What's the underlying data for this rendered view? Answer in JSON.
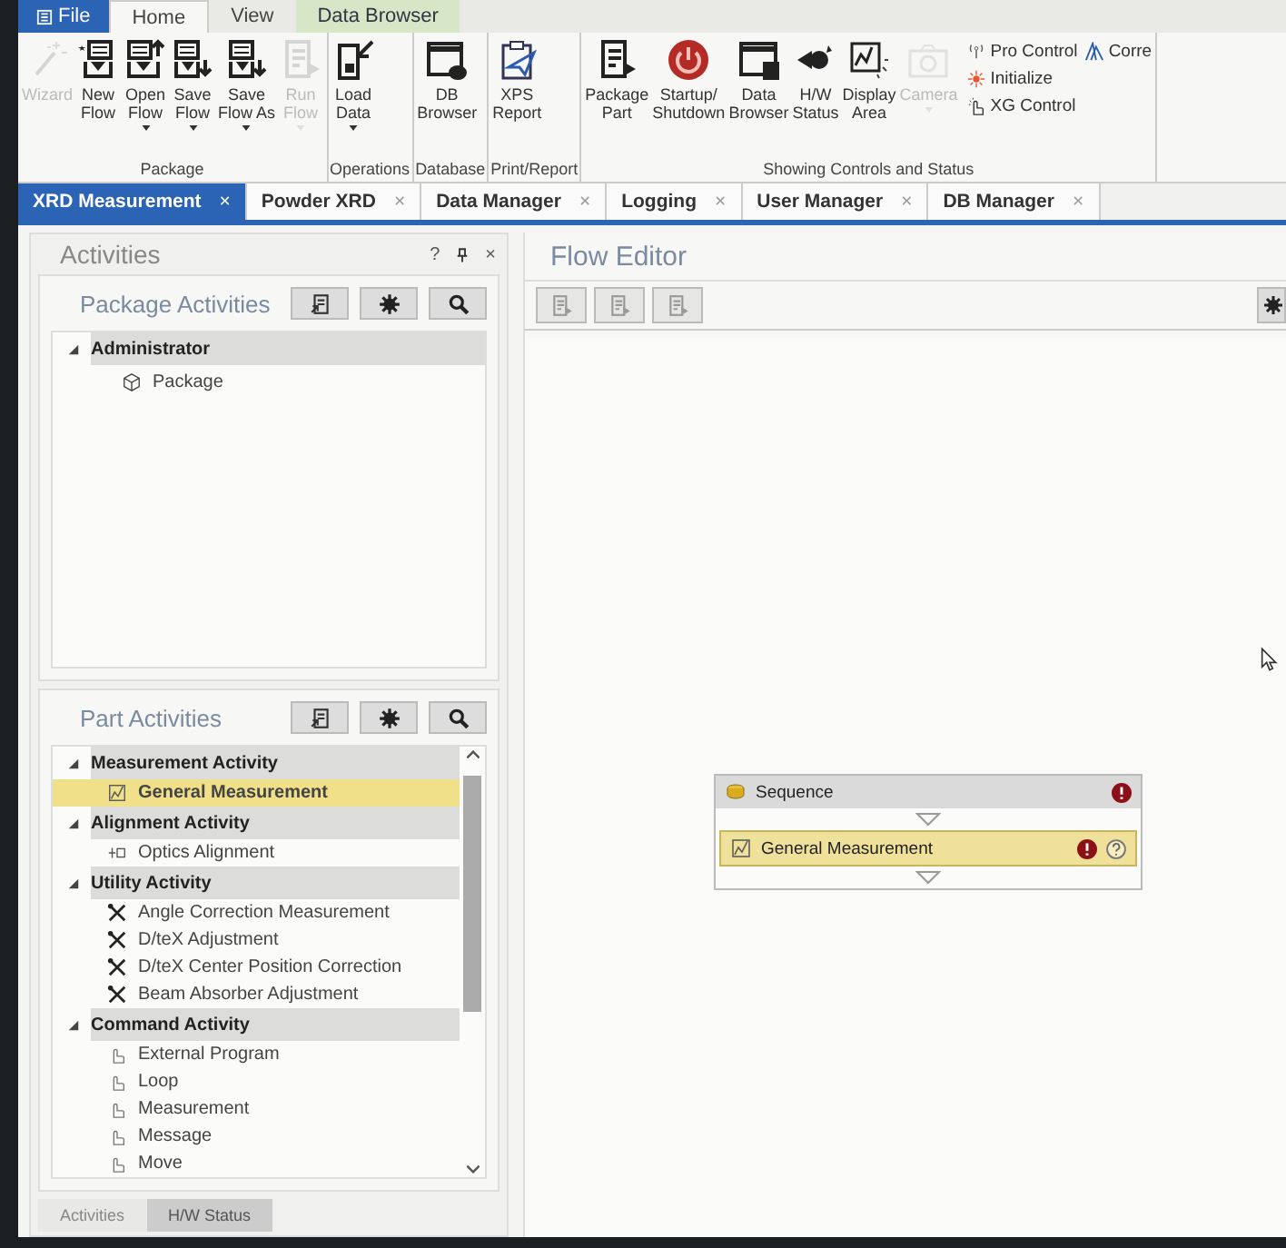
{
  "menu_tabs": [
    {
      "label": "File",
      "kind": "file",
      "selected": false
    },
    {
      "label": "Home",
      "kind": "normal",
      "selected": true
    },
    {
      "label": "View",
      "kind": "normal",
      "selected": false
    },
    {
      "label": "Data Browser",
      "kind": "contextual",
      "selected": false
    }
  ],
  "ribbon": {
    "groups": [
      {
        "label": "Package",
        "buttons": [
          {
            "lines": [
              "Wizard"
            ],
            "kind": "wand",
            "disabled": true,
            "dropdown": false
          },
          {
            "lines": [
              "New",
              "Flow"
            ],
            "kind": "new",
            "disabled": false,
            "dropdown": false
          },
          {
            "lines": [
              "Open",
              "Flow"
            ],
            "kind": "open",
            "disabled": false,
            "dropdown": true
          },
          {
            "lines": [
              "Save",
              "Flow"
            ],
            "kind": "save",
            "disabled": false,
            "dropdown": true
          },
          {
            "lines": [
              "Save",
              "Flow As"
            ],
            "kind": "save",
            "disabled": false,
            "dropdown": true
          },
          {
            "lines": [
              "Run",
              "Flow"
            ],
            "kind": "run",
            "disabled": true,
            "dropdown": true
          }
        ]
      },
      {
        "label": "Operations",
        "buttons": [
          {
            "lines": [
              "Load",
              "Data"
            ],
            "kind": "load",
            "disabled": false,
            "dropdown": true
          }
        ]
      },
      {
        "label": "Database",
        "buttons": [
          {
            "lines": [
              "DB",
              "Browser"
            ],
            "kind": "database",
            "disabled": false,
            "dropdown": false
          }
        ]
      },
      {
        "label": "Print/Report",
        "buttons": [
          {
            "lines": [
              "XPS",
              "Report"
            ],
            "kind": "report",
            "disabled": false,
            "dropdown": false
          }
        ]
      },
      {
        "label": "Showing Controls and Status",
        "buttons": [
          {
            "lines": [
              "Package",
              "Part"
            ],
            "kind": "run",
            "disabled": false,
            "dropdown": false
          },
          {
            "lines": [
              "Startup/",
              "Shutdown"
            ],
            "kind": "power",
            "disabled": false,
            "dropdown": false
          },
          {
            "lines": [
              "Data",
              "Browser"
            ],
            "kind": "window",
            "disabled": false,
            "dropdown": false
          },
          {
            "lines": [
              "H/W",
              "Status"
            ],
            "kind": "device",
            "disabled": false,
            "dropdown": false
          },
          {
            "lines": [
              "Display",
              "Area"
            ],
            "kind": "chart",
            "disabled": false,
            "dropdown": false
          },
          {
            "lines": [
              "Camera"
            ],
            "kind": "camera",
            "disabled": true,
            "dropdown": true
          }
        ],
        "small_buttons": [
          {
            "label": "Pro Control",
            "kind": "antenna"
          },
          {
            "label": "Initialize",
            "kind": "sparkle"
          },
          {
            "label": "XG Control",
            "kind": "hand"
          },
          {
            "label": "Corre",
            "kind": "peak"
          }
        ]
      }
    ]
  },
  "doc_tabs": [
    {
      "label": "XRD Measurement",
      "close": "×",
      "selected": true
    },
    {
      "label": "Powder XRD",
      "close": "×",
      "selected": false
    },
    {
      "label": "Data Manager",
      "close": "×",
      "selected": false
    },
    {
      "label": "Logging",
      "close": "×",
      "selected": false
    },
    {
      "label": "User Manager",
      "close": "×",
      "selected": false
    },
    {
      "label": "DB Manager",
      "close": "×",
      "selected": false
    }
  ],
  "activities": {
    "title": "Activities",
    "help": "?",
    "close": "×",
    "package_activities": {
      "title": "Package Activities",
      "tree": [
        {
          "label": "Administrator",
          "expanded": true,
          "children": [
            {
              "label": "Package",
              "selected": false
            }
          ]
        }
      ]
    },
    "part_activities": {
      "title": "Part Activities",
      "tree": [
        {
          "label": "Measurement Activity",
          "expanded": true,
          "children": [
            {
              "label": "General Measurement",
              "kind": "measurement",
              "selected": true
            }
          ]
        },
        {
          "label": "Alignment Activity",
          "expanded": true,
          "children": [
            {
              "label": "Optics Alignment",
              "kind": "alignment",
              "selected": false
            }
          ]
        },
        {
          "label": "Utility Activity",
          "expanded": true,
          "children": [
            {
              "label": "Angle Correction Measurement",
              "kind": "tool",
              "selected": false
            },
            {
              "label": "D/teX Adjustment",
              "kind": "tool",
              "selected": false
            },
            {
              "label": "D/teX Center Position Correction",
              "kind": "tool",
              "selected": false
            },
            {
              "label": "Beam Absorber Adjustment",
              "kind": "tool",
              "selected": false
            }
          ]
        },
        {
          "label": "Command Activity",
          "expanded": true,
          "children": [
            {
              "label": "External Program",
              "kind": "command",
              "selected": false
            },
            {
              "label": "Loop",
              "kind": "command",
              "selected": false
            },
            {
              "label": "Measurement",
              "kind": "command",
              "selected": false
            },
            {
              "label": "Message",
              "kind": "command",
              "selected": false
            },
            {
              "label": "Move",
              "kind": "command",
              "selected": false
            }
          ]
        }
      ]
    },
    "bottom_tabs": [
      {
        "label": "Activities",
        "selected": true
      },
      {
        "label": "H/W Status",
        "selected": false
      }
    ]
  },
  "flow_editor": {
    "title": "Flow Editor",
    "flow": [
      {
        "label": "Sequence",
        "kind": "sequence",
        "error": true,
        "help": false
      },
      {
        "label": "General Measurement",
        "kind": "measurement",
        "error": true,
        "help": true
      }
    ]
  }
}
